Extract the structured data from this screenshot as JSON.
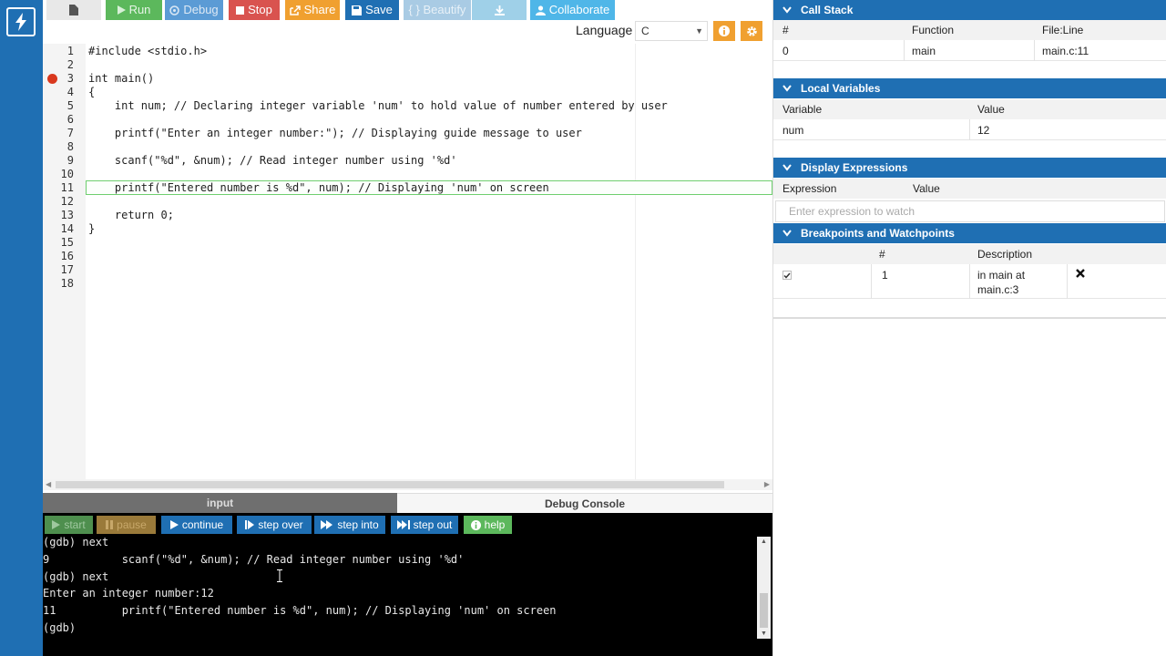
{
  "toolbar": {
    "run": "Run",
    "debug": "Debug",
    "stop": "Stop",
    "share": "Share",
    "save": "Save",
    "beautify": "{ } Beautify",
    "collaborate": "Collaborate",
    "language_label": "Language",
    "language_value": "C",
    "colors": {
      "run": "#5cb85c",
      "debug": "#5b9bd5",
      "stop": "#d9534f",
      "share": "#f0a030",
      "save": "#1f6fb3",
      "beautify": "#a9cbe4",
      "download": "#9fd0e8",
      "collaborate": "#4fb6e8"
    }
  },
  "editor": {
    "lines": [
      {
        "n": "1",
        "code": "#include <stdio.h>"
      },
      {
        "n": "2",
        "code": ""
      },
      {
        "n": "3",
        "code": "int main()"
      },
      {
        "n": "4",
        "code": "{"
      },
      {
        "n": "5",
        "code": "    int num; // Declaring integer variable 'num' to hold value of number entered by user"
      },
      {
        "n": "6",
        "code": ""
      },
      {
        "n": "7",
        "code": "    printf(\"Enter an integer number:\"); // Displaying guide message to user"
      },
      {
        "n": "8",
        "code": ""
      },
      {
        "n": "9",
        "code": "    scanf(\"%d\", &num); // Read integer number using '%d'"
      },
      {
        "n": "10",
        "code": ""
      },
      {
        "n": "11",
        "code": "    printf(\"Entered number is %d\", num); // Displaying 'num' on screen"
      },
      {
        "n": "12",
        "code": ""
      },
      {
        "n": "13",
        "code": "    return 0;"
      },
      {
        "n": "14",
        "code": "}"
      },
      {
        "n": "15",
        "code": ""
      },
      {
        "n": "16",
        "code": ""
      },
      {
        "n": "17",
        "code": ""
      },
      {
        "n": "18",
        "code": ""
      }
    ]
  },
  "bottom_tabs": {
    "input": "input",
    "console": "Debug Console"
  },
  "console": {
    "buttons": {
      "start": "start",
      "pause": "pause",
      "continue": "continue",
      "step_over": "step over",
      "step_into": "step into",
      "step_out": "step out",
      "help": "help"
    },
    "output": [
      "(gdb) next",
      "9           scanf(\"%d\", &num); // Read integer number using '%d'",
      "(gdb) next",
      "Enter an integer number:12",
      "11          printf(\"Entered number is %d\", num); // Displaying 'num' on screen",
      "(gdb)"
    ]
  },
  "call_stack": {
    "title": "Call Stack",
    "headers": [
      "#",
      "Function",
      "File:Line"
    ],
    "rows": [
      [
        "0",
        "main",
        "main.c:11"
      ]
    ]
  },
  "local_variables": {
    "title": "Local Variables",
    "headers": [
      "Variable",
      "Value"
    ],
    "rows": [
      [
        "num",
        "12"
      ]
    ]
  },
  "display_expressions": {
    "title": "Display Expressions",
    "headers": [
      "Expression",
      "Value"
    ],
    "placeholder": "Enter expression to watch"
  },
  "breakpoints": {
    "title": "Breakpoints and Watchpoints",
    "headers": [
      "#",
      "Description"
    ],
    "rows": [
      {
        "num": "1",
        "desc_line1": "in main at",
        "desc_line2": "main.c:3"
      }
    ]
  }
}
